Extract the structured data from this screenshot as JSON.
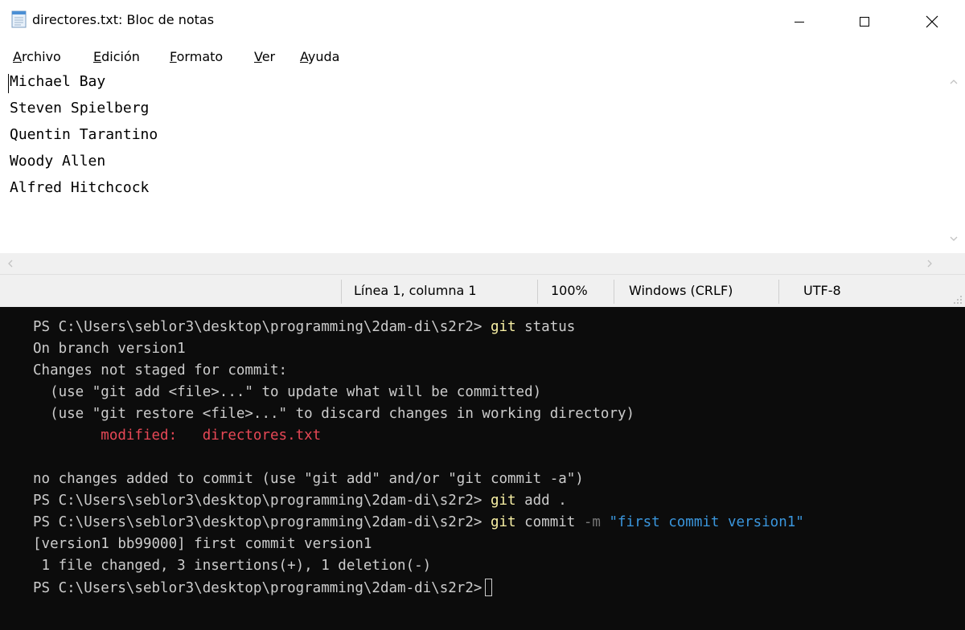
{
  "notepad": {
    "title": "directores.txt: Bloc de notas",
    "window_controls": {
      "minimize": "minimize-icon",
      "maximize": "maximize-icon",
      "close": "close-icon"
    },
    "menu": [
      "Archivo",
      "Edición",
      "Formato",
      "Ver",
      "Ayuda"
    ],
    "editor_lines": [
      "Michael Bay",
      "Steven Spielberg",
      "Quentin Tarantino",
      "Woody Allen",
      "Alfred Hitchcock"
    ],
    "status": {
      "position": "Línea 1, columna 1",
      "zoom": "100%",
      "line_ending": "Windows (CRLF)",
      "encoding": "UTF-8"
    }
  },
  "terminal": {
    "prompt": "PS C:\\Users\\seblor3\\desktop\\programming\\2dam-di\\s2r2>",
    "lines": [
      {
        "kind": "command",
        "cmd": "git",
        "rest": " status"
      },
      {
        "kind": "text",
        "text": "On branch version1"
      },
      {
        "kind": "text",
        "text": "Changes not staged for commit:"
      },
      {
        "kind": "text",
        "text": "  (use \"git add <file>...\" to update what will be committed)"
      },
      {
        "kind": "text",
        "text": "  (use \"git restore <file>...\" to discard changes in working directory)"
      },
      {
        "kind": "red",
        "text": "        modified:   directores.txt"
      },
      {
        "kind": "text",
        "text": ""
      },
      {
        "kind": "text",
        "text": "no changes added to commit (use \"git add\" and/or \"git commit -a\")"
      },
      {
        "kind": "command",
        "cmd": "git",
        "rest": " add ."
      },
      {
        "kind": "command",
        "cmd": "git",
        "rest": " commit ",
        "flag": "-m",
        "str": " \"first commit version1\""
      },
      {
        "kind": "text",
        "text": "[version1 bb99000] first commit version1"
      },
      {
        "kind": "text",
        "text": " 1 file changed, 3 insertions(+), 1 deletion(-)"
      },
      {
        "kind": "cursor"
      }
    ],
    "colors": {
      "background": "#0c0c0c",
      "text": "#cccccc",
      "command": "#f9f1a5",
      "flag": "#767676",
      "string": "#3a96dd",
      "modified": "#e74856"
    }
  }
}
